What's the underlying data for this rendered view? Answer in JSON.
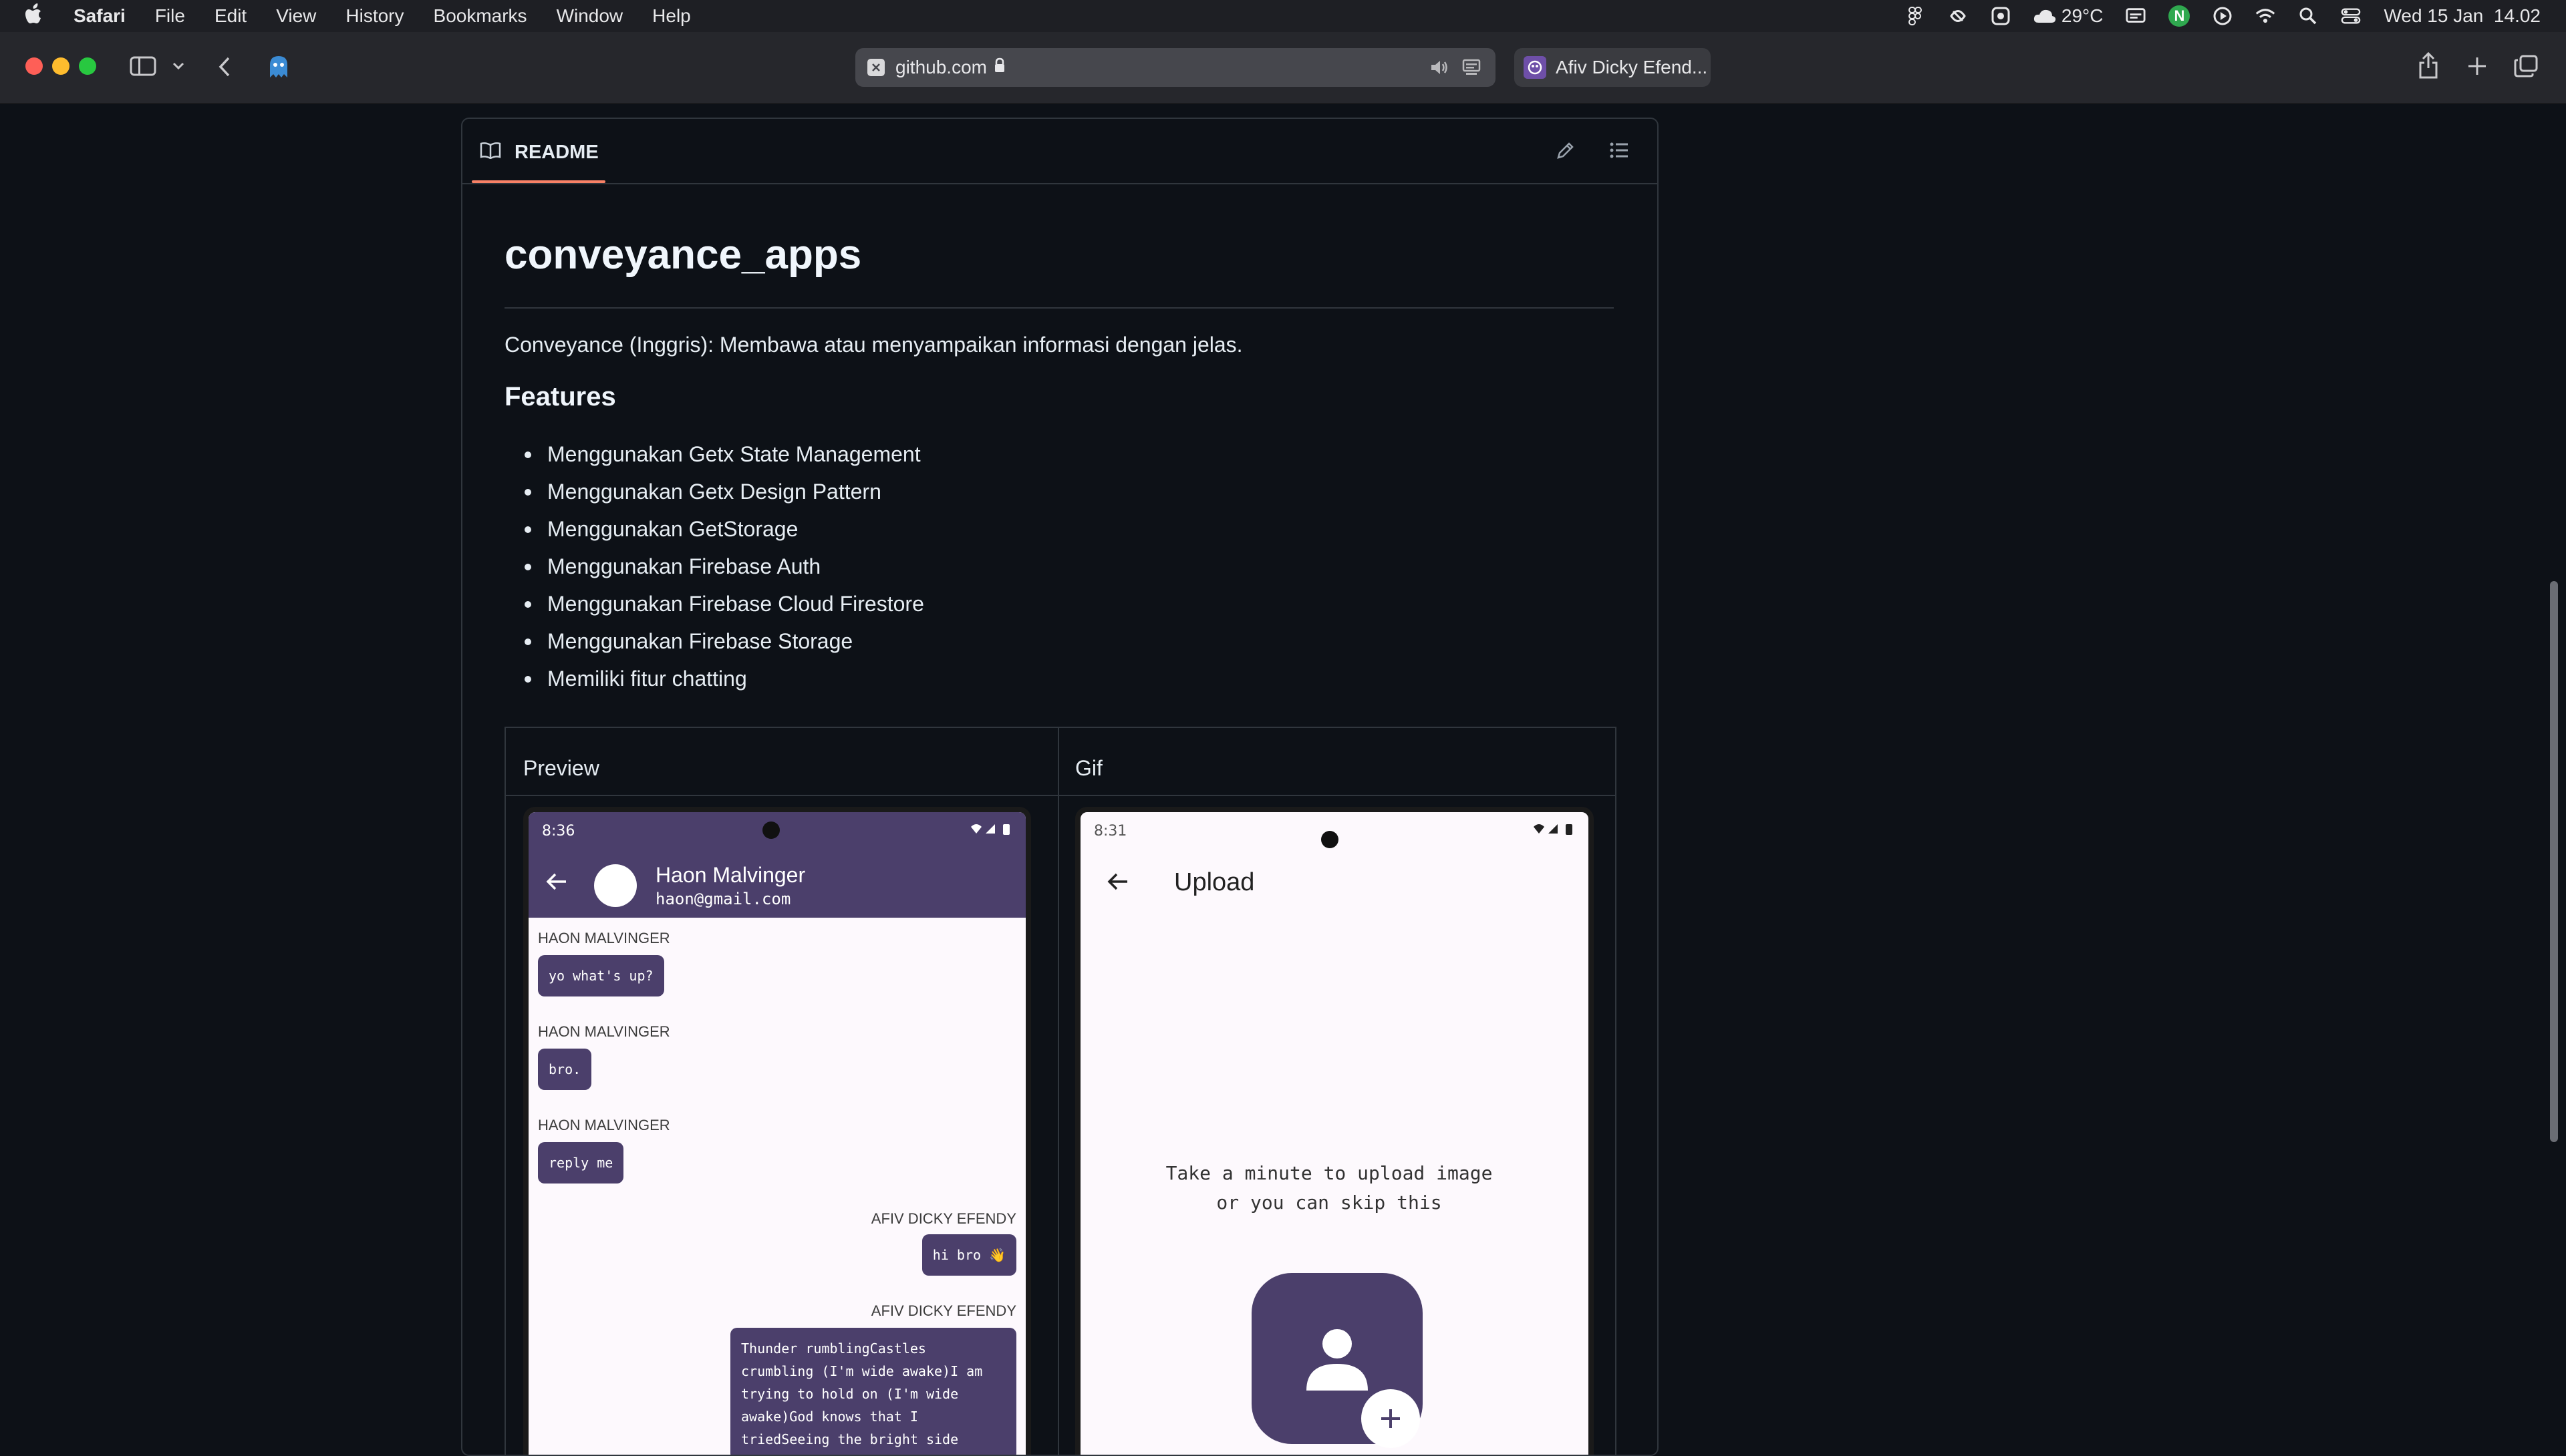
{
  "menubar": {
    "app": "Safari",
    "items": [
      "File",
      "Edit",
      "View",
      "History",
      "Bookmarks",
      "Window",
      "Help"
    ],
    "weather": "29°C",
    "datetime": "Wed 15 Jan  14.02",
    "account_initial": "N"
  },
  "browser": {
    "address": "github.com",
    "tab_title": "Afiv Dicky Efend..."
  },
  "readme": {
    "tab_label": "README",
    "title": "conveyance_apps",
    "description": "Conveyance (Inggris): Membawa atau menyampaikan informasi dengan jelas.",
    "features_heading": "Features",
    "features": [
      "Menggunakan Getx State Management",
      "Menggunakan Getx Design Pattern",
      "Menggunakan GetStorage",
      "Menggunakan Firebase Auth",
      "Menggunakan Firebase Cloud Firestore",
      "Menggunakan Firebase Storage",
      "Memiliki fitur chatting"
    ],
    "table": {
      "headers": [
        "Preview",
        "Gif"
      ]
    }
  },
  "preview_phone": {
    "time": "8:36",
    "contact_name": "Haon Malvinger",
    "contact_email": "haon@gmail.com",
    "messages": [
      {
        "sender": "HAON MALVINGER",
        "text": "yo what's up?"
      },
      {
        "sender": "HAON MALVINGER",
        "text": "bro."
      },
      {
        "sender": "HAON MALVINGER",
        "text": "reply me"
      },
      {
        "sender": "AFIV DICKY EFENDY",
        "text": "hi bro 👋"
      },
      {
        "sender": "AFIV DICKY EFENDY",
        "text": "Thunder rumblingCastles crumbling (I'm wide awake)I am trying to hold on (I'm wide awake)God knows that I triedSeeing the bright side"
      }
    ]
  },
  "gif_phone": {
    "time": "8:31",
    "title": "Upload",
    "prompt_line1": "Take a minute to upload image",
    "prompt_line2": "or you can skip this"
  }
}
